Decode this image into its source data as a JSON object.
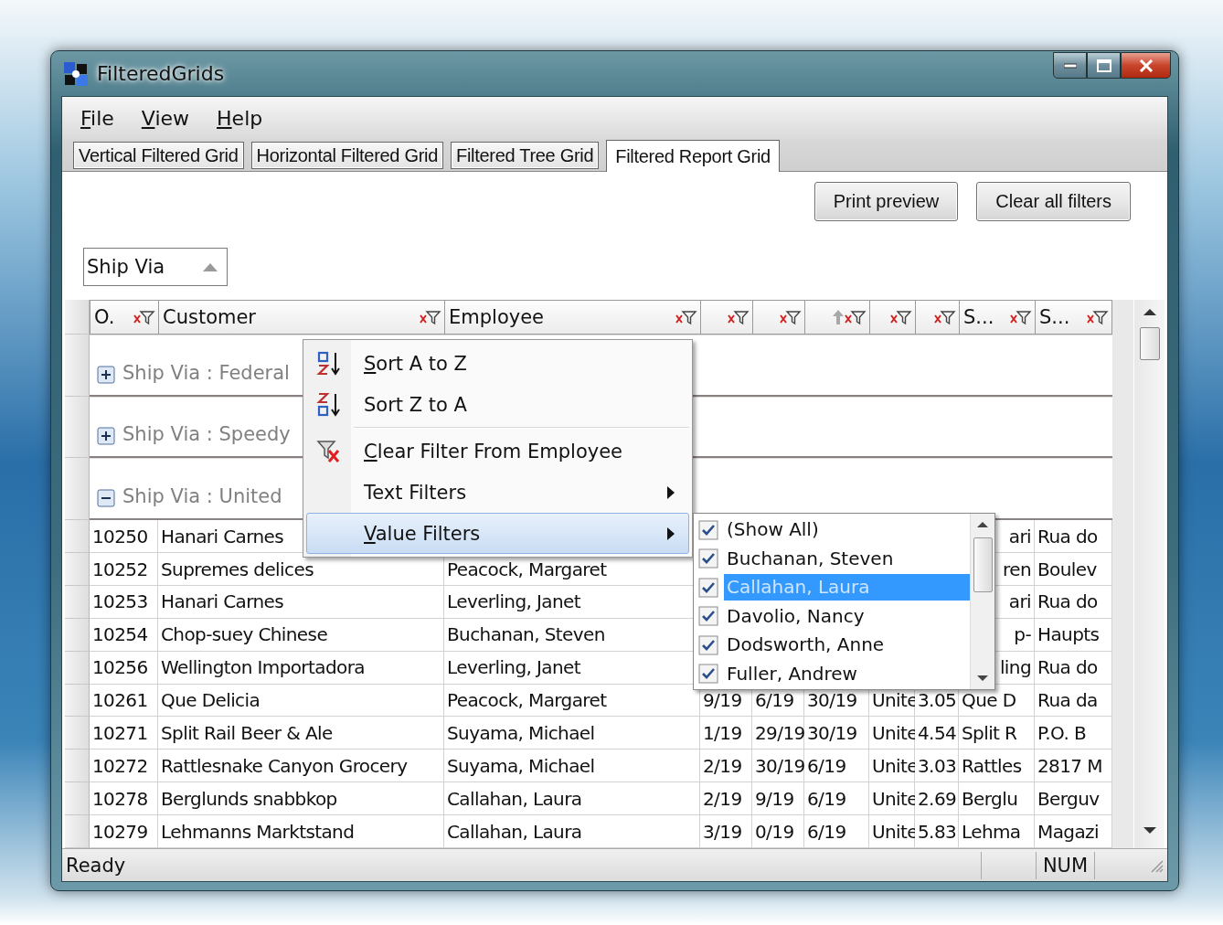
{
  "window": {
    "title": "FilteredGrids"
  },
  "menu_bar": [
    "File",
    "View",
    "Help"
  ],
  "tabs": [
    {
      "label": "Vertical Filtered Grid",
      "selected": false
    },
    {
      "label": "Horizontal Filtered Grid",
      "selected": false
    },
    {
      "label": "Filtered Tree Grid",
      "selected": false
    },
    {
      "label": "Filtered Report Grid",
      "selected": true
    }
  ],
  "toolbar": {
    "buttons": [
      "Print preview",
      "Clear all filters"
    ]
  },
  "group_by": {
    "label": "Ship Via"
  },
  "grid": {
    "columns": [
      {
        "label": "O.",
        "sorted": false
      },
      {
        "label": "Customer",
        "sorted": false
      },
      {
        "label": "Employee",
        "sorted": false
      },
      {
        "sorted": false
      },
      {
        "sorted": false
      },
      {
        "sorted": true
      },
      {
        "sorted": false
      },
      {
        "sorted": false
      },
      {
        "label": "S...",
        "sorted": false
      },
      {
        "label": "S...",
        "sorted": false
      }
    ],
    "groups": [
      {
        "label": "Ship Via : Federal",
        "expanded": false
      },
      {
        "label": "Ship Via : Speedy",
        "expanded": false
      },
      {
        "label": "Ship Via : United",
        "expanded": true
      }
    ],
    "rows": [
      {
        "cells": [
          "10250",
          "Hanari Carnes",
          null,
          null,
          null,
          null,
          null,
          null,
          {
            "text": "ari",
            "cut": true
          },
          "Rua do"
        ]
      },
      {
        "cells": [
          "10252",
          "Supremes delices",
          "Peacock, Margaret",
          null,
          null,
          null,
          null,
          null,
          {
            "text": "ren",
            "cut": true
          },
          "Boulev"
        ]
      },
      {
        "cells": [
          "10253",
          "Hanari Carnes",
          "Leverling, Janet",
          null,
          null,
          null,
          null,
          null,
          {
            "text": "ari",
            "cut": true
          },
          "Rua do"
        ]
      },
      {
        "cells": [
          "10254",
          "Chop-suey Chinese",
          "Buchanan, Steven",
          null,
          null,
          null,
          null,
          null,
          {
            "text": "p-",
            "cut": true
          },
          "Haupts"
        ]
      },
      {
        "cells": [
          "10256",
          "Wellington Importadora",
          "Leverling, Janet",
          null,
          null,
          null,
          null,
          null,
          {
            "text": "ling",
            "cut": true
          },
          "Rua do"
        ]
      },
      {
        "cells": [
          "10261",
          "Que Delicia",
          "Peacock, Margaret",
          "9/19",
          "6/19",
          "30/19",
          "Unite",
          "3.05",
          "Que D",
          "Rua da"
        ]
      },
      {
        "cells": [
          "10271",
          "Split Rail Beer & Ale",
          "Suyama, Michael",
          "1/19",
          "29/19",
          "30/19",
          "Unite",
          "4.54",
          "Split R",
          "P.O. B"
        ]
      },
      {
        "cells": [
          "10272",
          "Rattlesnake Canyon Grocery",
          "Suyama, Michael",
          "2/19",
          "30/19",
          "6/19",
          "Unite",
          "3.03",
          "Rattles",
          "2817 M"
        ]
      },
      {
        "cells": [
          "10278",
          "Berglunds snabbkop",
          "Callahan, Laura",
          "2/19",
          "9/19",
          "6/19",
          "Unite",
          "2.69",
          "Berglu",
          "Berguv"
        ]
      },
      {
        "cells": [
          "10279",
          "Lehmanns Marktstand",
          "Callahan, Laura",
          "3/19",
          "0/19",
          "6/19",
          "Unite",
          "5.83",
          "Lehma",
          "Magazi"
        ]
      }
    ]
  },
  "context_menu": {
    "items": [
      {
        "kind": "sort_ascending",
        "label": "Sort A to Z",
        "underline_first": true,
        "submenu": false,
        "selected": false
      },
      {
        "kind": "sort_descending",
        "label": "Sort Z to A",
        "underline_first": false,
        "submenu": false,
        "selected": false
      },
      {
        "kind": "separator"
      },
      {
        "kind": "clear_filter",
        "label": "Clear Filter From Employee",
        "underline_first": true,
        "submenu": false,
        "selected": false
      },
      {
        "kind": "plain",
        "label": "Text Filters",
        "underline_first": false,
        "submenu": true,
        "selected": false
      },
      {
        "kind": "plain",
        "label": "Value Filters",
        "underline_first": true,
        "submenu": true,
        "selected": true
      }
    ]
  },
  "value_filter_list": {
    "items": [
      {
        "label": "(Show All)",
        "checked": true,
        "selected": false
      },
      {
        "label": "Buchanan, Steven",
        "checked": true,
        "selected": false
      },
      {
        "label": "Callahan, Laura",
        "checked": true,
        "selected": true
      },
      {
        "label": "Davolio, Nancy",
        "checked": true,
        "selected": false
      },
      {
        "label": "Dodsworth, Anne",
        "checked": true,
        "selected": false
      },
      {
        "label": "Fuller, Andrew",
        "checked": true,
        "selected": false
      }
    ]
  },
  "status_bar": {
    "text": "Ready",
    "indicators": [
      "NUM"
    ]
  }
}
